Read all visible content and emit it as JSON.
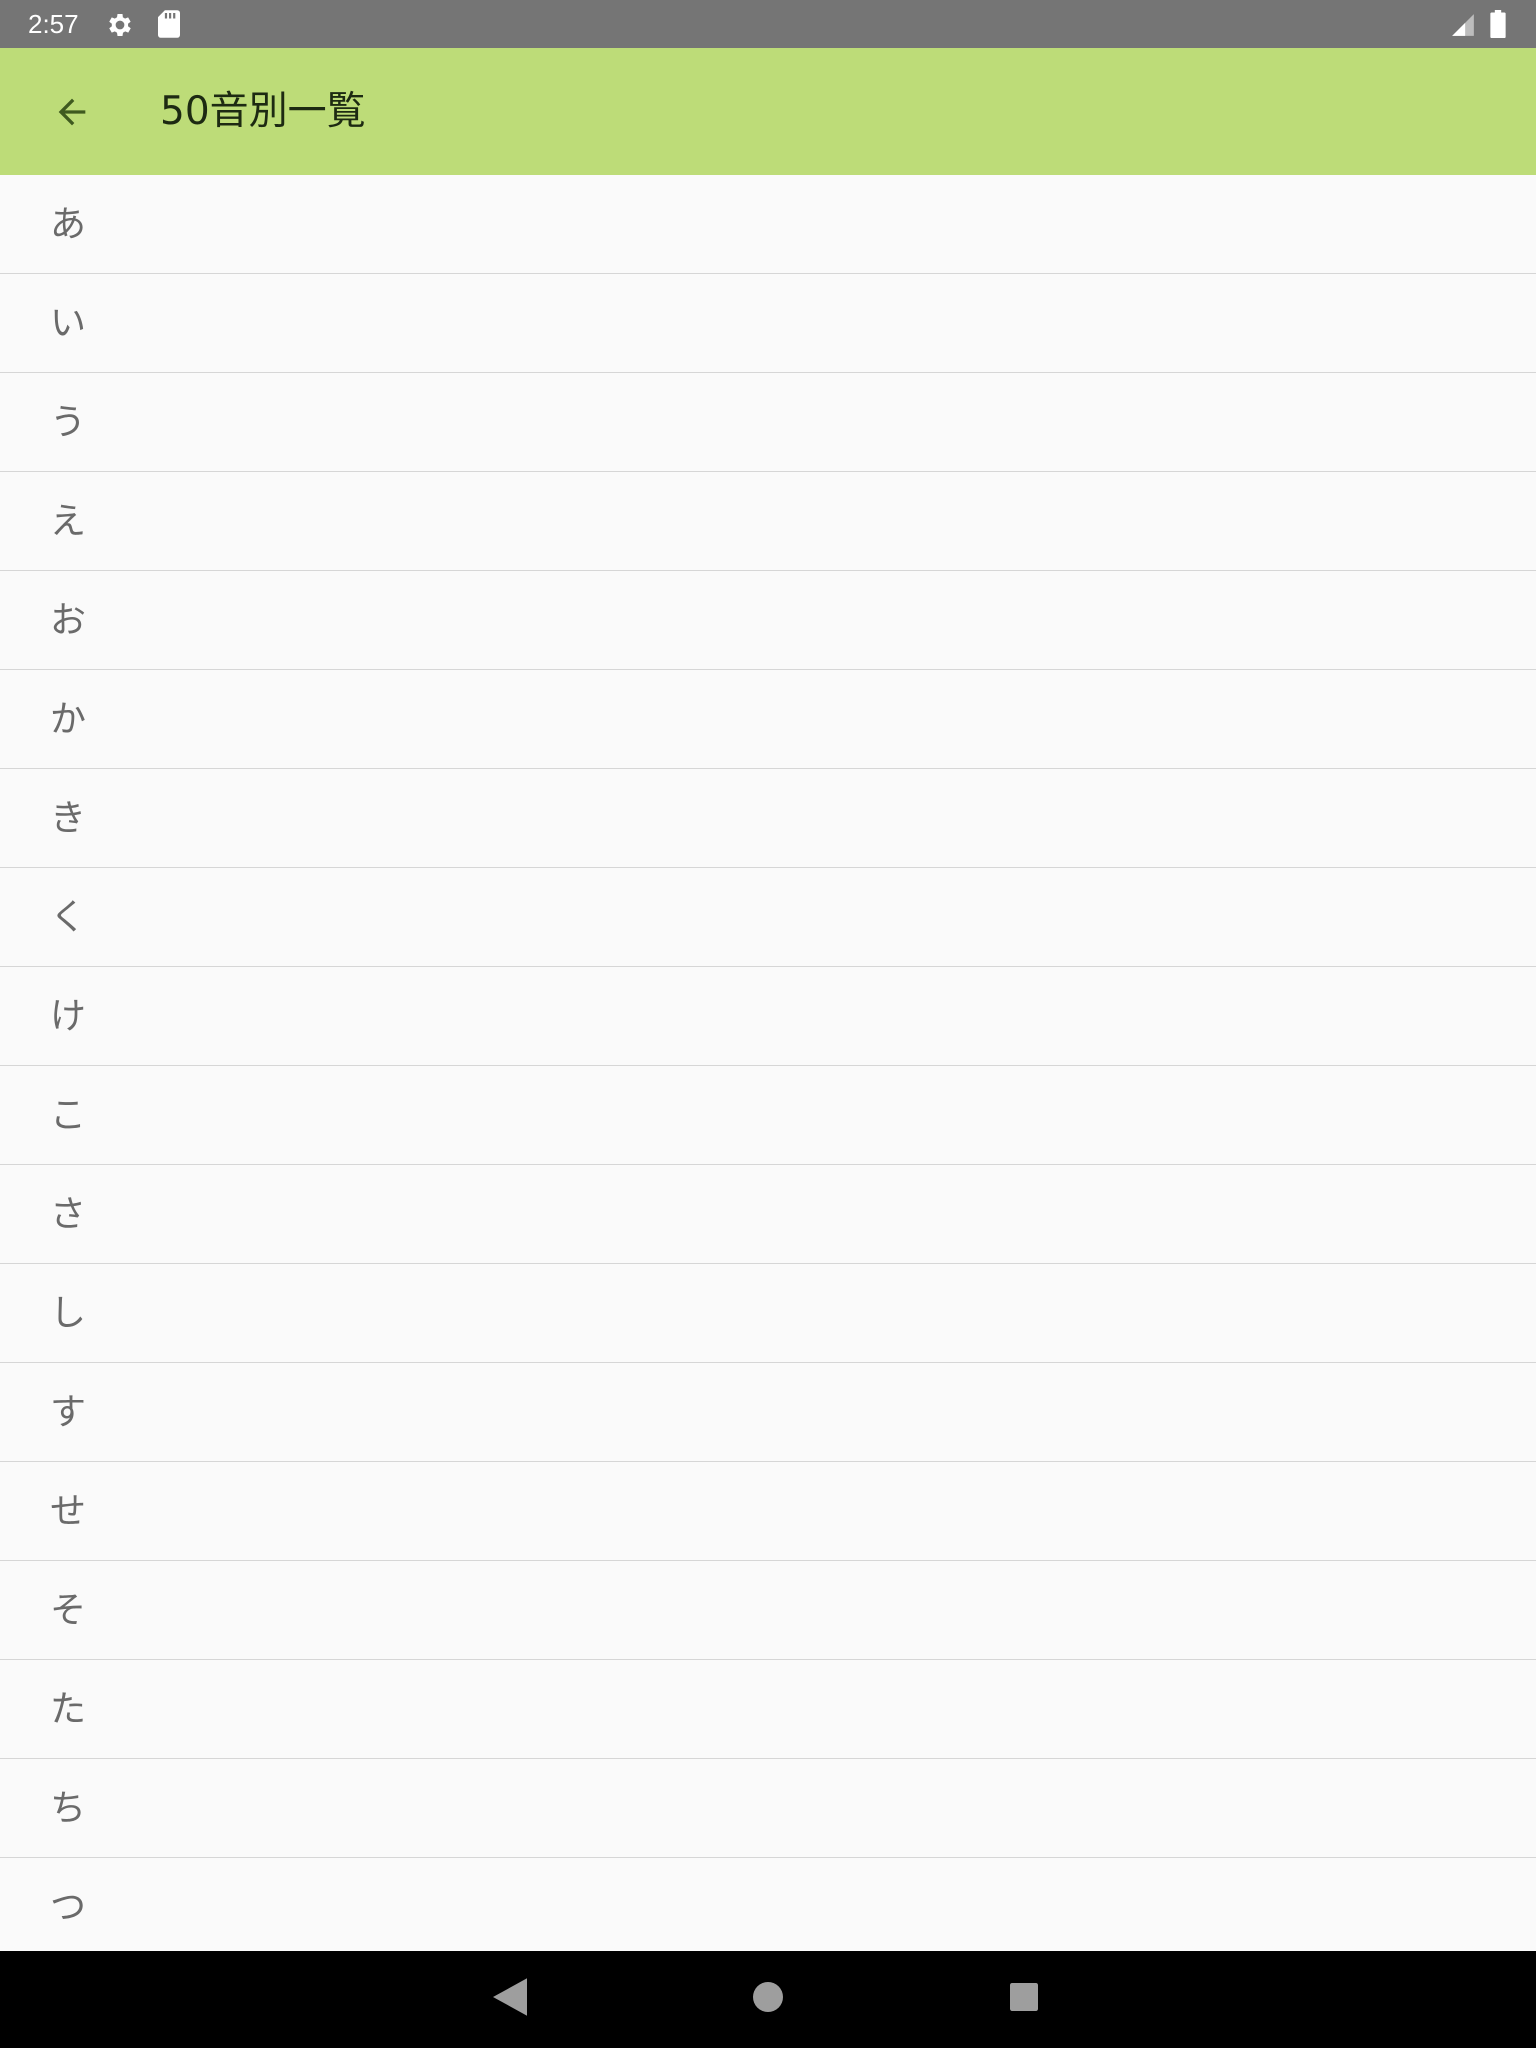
{
  "status_bar": {
    "time": "2:57",
    "icons": [
      "gear-icon",
      "sd-card-icon",
      "signal-icon",
      "battery-icon"
    ],
    "color": "#757575"
  },
  "app_bar": {
    "title": "50音別一覧",
    "back_icon": "arrow-left-icon",
    "color": "#bddc78"
  },
  "list": {
    "items": [
      {
        "label": "あ"
      },
      {
        "label": "い"
      },
      {
        "label": "う"
      },
      {
        "label": "え"
      },
      {
        "label": "お"
      },
      {
        "label": "か"
      },
      {
        "label": "き"
      },
      {
        "label": "く"
      },
      {
        "label": "け"
      },
      {
        "label": "こ"
      },
      {
        "label": "さ"
      },
      {
        "label": "し"
      },
      {
        "label": "す"
      },
      {
        "label": "せ"
      },
      {
        "label": "そ"
      },
      {
        "label": "た"
      },
      {
        "label": "ち"
      },
      {
        "label": "つ"
      }
    ]
  },
  "nav_bar": {
    "icons": [
      "nav-back-icon",
      "nav-home-icon",
      "nav-recents-icon"
    ]
  }
}
